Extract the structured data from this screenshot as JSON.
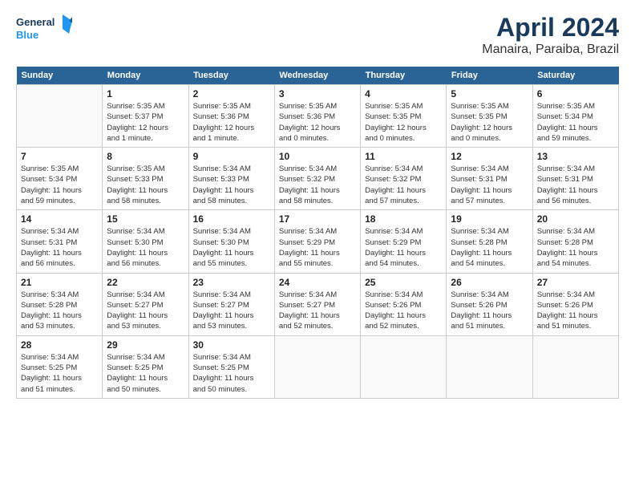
{
  "header": {
    "logo_line1": "General",
    "logo_line2": "Blue",
    "main_title": "April 2024",
    "subtitle": "Manaira, Paraiba, Brazil"
  },
  "calendar": {
    "days_of_week": [
      "Sunday",
      "Monday",
      "Tuesday",
      "Wednesday",
      "Thursday",
      "Friday",
      "Saturday"
    ],
    "weeks": [
      [
        {
          "day": "",
          "info": ""
        },
        {
          "day": "1",
          "info": "Sunrise: 5:35 AM\nSunset: 5:37 PM\nDaylight: 12 hours\nand 1 minute."
        },
        {
          "day": "2",
          "info": "Sunrise: 5:35 AM\nSunset: 5:36 PM\nDaylight: 12 hours\nand 1 minute."
        },
        {
          "day": "3",
          "info": "Sunrise: 5:35 AM\nSunset: 5:36 PM\nDaylight: 12 hours\nand 0 minutes."
        },
        {
          "day": "4",
          "info": "Sunrise: 5:35 AM\nSunset: 5:35 PM\nDaylight: 12 hours\nand 0 minutes."
        },
        {
          "day": "5",
          "info": "Sunrise: 5:35 AM\nSunset: 5:35 PM\nDaylight: 12 hours\nand 0 minutes."
        },
        {
          "day": "6",
          "info": "Sunrise: 5:35 AM\nSunset: 5:34 PM\nDaylight: 11 hours\nand 59 minutes."
        }
      ],
      [
        {
          "day": "7",
          "info": "Sunrise: 5:35 AM\nSunset: 5:34 PM\nDaylight: 11 hours\nand 59 minutes."
        },
        {
          "day": "8",
          "info": "Sunrise: 5:35 AM\nSunset: 5:33 PM\nDaylight: 11 hours\nand 58 minutes."
        },
        {
          "day": "9",
          "info": "Sunrise: 5:34 AM\nSunset: 5:33 PM\nDaylight: 11 hours\nand 58 minutes."
        },
        {
          "day": "10",
          "info": "Sunrise: 5:34 AM\nSunset: 5:32 PM\nDaylight: 11 hours\nand 58 minutes."
        },
        {
          "day": "11",
          "info": "Sunrise: 5:34 AM\nSunset: 5:32 PM\nDaylight: 11 hours\nand 57 minutes."
        },
        {
          "day": "12",
          "info": "Sunrise: 5:34 AM\nSunset: 5:31 PM\nDaylight: 11 hours\nand 57 minutes."
        },
        {
          "day": "13",
          "info": "Sunrise: 5:34 AM\nSunset: 5:31 PM\nDaylight: 11 hours\nand 56 minutes."
        }
      ],
      [
        {
          "day": "14",
          "info": "Sunrise: 5:34 AM\nSunset: 5:31 PM\nDaylight: 11 hours\nand 56 minutes."
        },
        {
          "day": "15",
          "info": "Sunrise: 5:34 AM\nSunset: 5:30 PM\nDaylight: 11 hours\nand 56 minutes."
        },
        {
          "day": "16",
          "info": "Sunrise: 5:34 AM\nSunset: 5:30 PM\nDaylight: 11 hours\nand 55 minutes."
        },
        {
          "day": "17",
          "info": "Sunrise: 5:34 AM\nSunset: 5:29 PM\nDaylight: 11 hours\nand 55 minutes."
        },
        {
          "day": "18",
          "info": "Sunrise: 5:34 AM\nSunset: 5:29 PM\nDaylight: 11 hours\nand 54 minutes."
        },
        {
          "day": "19",
          "info": "Sunrise: 5:34 AM\nSunset: 5:28 PM\nDaylight: 11 hours\nand 54 minutes."
        },
        {
          "day": "20",
          "info": "Sunrise: 5:34 AM\nSunset: 5:28 PM\nDaylight: 11 hours\nand 54 minutes."
        }
      ],
      [
        {
          "day": "21",
          "info": "Sunrise: 5:34 AM\nSunset: 5:28 PM\nDaylight: 11 hours\nand 53 minutes."
        },
        {
          "day": "22",
          "info": "Sunrise: 5:34 AM\nSunset: 5:27 PM\nDaylight: 11 hours\nand 53 minutes."
        },
        {
          "day": "23",
          "info": "Sunrise: 5:34 AM\nSunset: 5:27 PM\nDaylight: 11 hours\nand 53 minutes."
        },
        {
          "day": "24",
          "info": "Sunrise: 5:34 AM\nSunset: 5:27 PM\nDaylight: 11 hours\nand 52 minutes."
        },
        {
          "day": "25",
          "info": "Sunrise: 5:34 AM\nSunset: 5:26 PM\nDaylight: 11 hours\nand 52 minutes."
        },
        {
          "day": "26",
          "info": "Sunrise: 5:34 AM\nSunset: 5:26 PM\nDaylight: 11 hours\nand 51 minutes."
        },
        {
          "day": "27",
          "info": "Sunrise: 5:34 AM\nSunset: 5:26 PM\nDaylight: 11 hours\nand 51 minutes."
        }
      ],
      [
        {
          "day": "28",
          "info": "Sunrise: 5:34 AM\nSunset: 5:25 PM\nDaylight: 11 hours\nand 51 minutes."
        },
        {
          "day": "29",
          "info": "Sunrise: 5:34 AM\nSunset: 5:25 PM\nDaylight: 11 hours\nand 50 minutes."
        },
        {
          "day": "30",
          "info": "Sunrise: 5:34 AM\nSunset: 5:25 PM\nDaylight: 11 hours\nand 50 minutes."
        },
        {
          "day": "",
          "info": ""
        },
        {
          "day": "",
          "info": ""
        },
        {
          "day": "",
          "info": ""
        },
        {
          "day": "",
          "info": ""
        }
      ]
    ]
  }
}
